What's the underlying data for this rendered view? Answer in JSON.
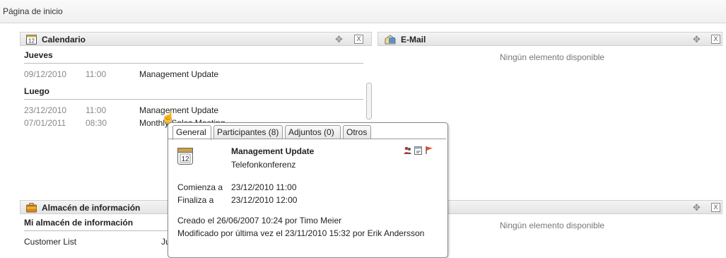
{
  "page": {
    "title": "Página de inicio"
  },
  "calendar": {
    "title": "Calendario",
    "icon_day": "12",
    "section_today": "Jueves",
    "today_items": [
      {
        "date": "09/12/2010",
        "time": "11:00",
        "subject": "Management Update"
      }
    ],
    "section_later": "Luego",
    "later_items": [
      {
        "date": "23/12/2010",
        "time": "11:00",
        "subject": "Management Update"
      },
      {
        "date": "07/01/2011",
        "time": "08:30",
        "subject": "Monthly Sales Meeting"
      }
    ]
  },
  "email": {
    "title": "E-Mail",
    "empty": "Ningún elemento disponible"
  },
  "storage": {
    "title": "Almacén de información",
    "section": "Mi almacén de información",
    "items": [
      {
        "name": "Customer List",
        "date": "Ju"
      }
    ]
  },
  "right_lower": {
    "empty": "Ningún elemento disponible"
  },
  "popup": {
    "tabs": [
      "General",
      "Participantes (8)",
      "Adjuntos (0)",
      "Otros"
    ],
    "icon_day": "12",
    "title": "Management Update",
    "location": "Telefonkonferenz",
    "start_label": "Comienza a",
    "start_value": "23/12/2010 11:00",
    "end_label": "Finaliza a",
    "end_value": "23/12/2010 12:00",
    "created": "Creado el 26/06/2007 10:24 por Timo Meier",
    "modified": "Modificado por última vez el 23/11/2010 15:32 por Erik Andersson"
  },
  "colors": {
    "flag": "#e8502a",
    "email_icon": "#3a7bd5",
    "storage_icon": "#d98b1a"
  }
}
